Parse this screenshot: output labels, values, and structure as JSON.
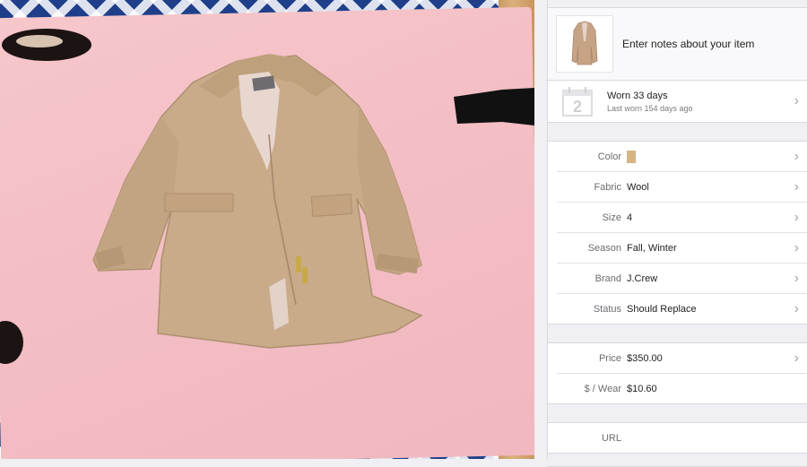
{
  "item": {
    "notes_placeholder": "Enter notes about your item",
    "thumbnail_icon": "coat-thumbnail-icon"
  },
  "wear": {
    "calendar_day": "2",
    "worn_text": "Worn 33 days",
    "last_worn_text": "Last worn 154 days ago"
  },
  "details": [
    {
      "label": "Color",
      "value": "",
      "swatch": "#d6b486"
    },
    {
      "label": "Fabric",
      "value": "Wool"
    },
    {
      "label": "Size",
      "value": "4"
    },
    {
      "label": "Season",
      "value": "Fall, Winter"
    },
    {
      "label": "Brand",
      "value": "J.Crew"
    },
    {
      "label": "Status",
      "value": "Should Replace"
    }
  ],
  "cost": [
    {
      "label": "Price",
      "value": "$350.00"
    },
    {
      "label": "$ / Wear",
      "value": "$10.60"
    }
  ],
  "link": {
    "label": "URL",
    "value": ""
  },
  "colors": {
    "mat_pink": "#f3bec4",
    "coat_camel": "#c9ab8a",
    "rug_blue": "#1f3f8a"
  }
}
